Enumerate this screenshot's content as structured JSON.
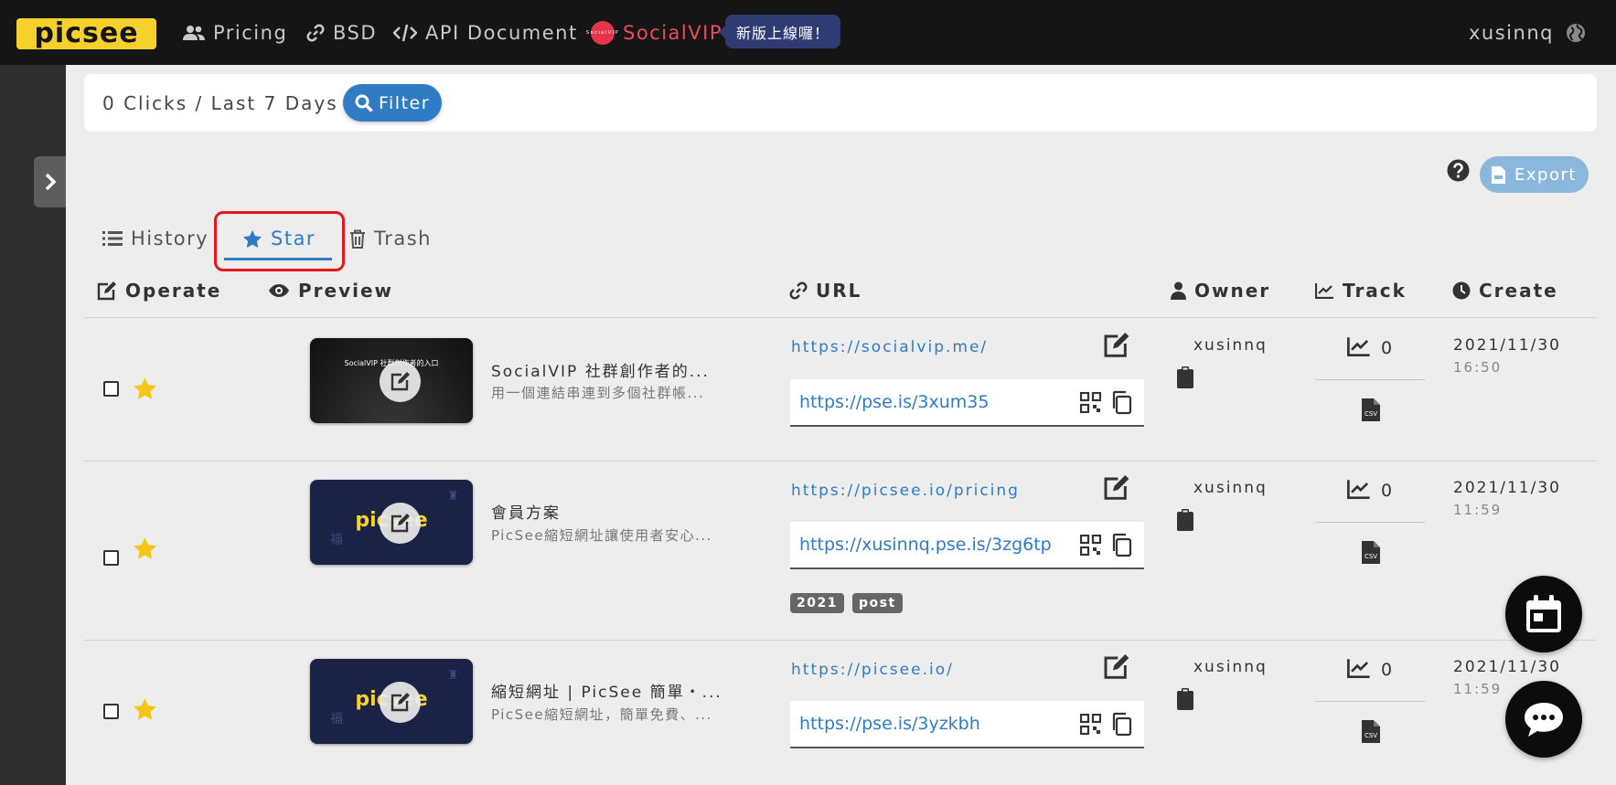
{
  "nav": {
    "logo": "picsee",
    "items": [
      {
        "label": "Pricing",
        "icon": "users-icon"
      },
      {
        "label": "BSD",
        "icon": "link-icon"
      },
      {
        "label": "API Document",
        "icon": "code-icon"
      },
      {
        "label": "SocialVIP",
        "icon": "socialvip-icon",
        "color": "#ef4a5c"
      }
    ],
    "socialvip_logo_text": "SocialVIP",
    "new_badge": "新版上線囉！",
    "user": "xusinnq"
  },
  "summary": {
    "text": "0 Clicks / Last 7 Days",
    "filter_label": "Filter"
  },
  "toolbar": {
    "export_label": "Export"
  },
  "tabs": [
    {
      "label": "History",
      "icon": "list-icon"
    },
    {
      "label": "Star",
      "icon": "star-icon",
      "active": true
    },
    {
      "label": "Trash",
      "icon": "trash-icon"
    }
  ],
  "columns": [
    "Operate",
    "Preview",
    "URL",
    "Owner",
    "Track",
    "Create"
  ],
  "rows": [
    {
      "starred": true,
      "thumb_type": "socialvip",
      "thumb_title": "SocialVIP 社群創作者的入口",
      "title": "SocialVIP 社群創作者的...",
      "description": "用一個連結串連到多個社群帳...",
      "original_url": "https://socialvip.me/",
      "short_url": "https://pse.is/3xum35",
      "tags": [],
      "owner": "xusinnq",
      "clicks": "0",
      "date": "2021/11/30",
      "time": "16:50"
    },
    {
      "starred": true,
      "thumb_type": "picsee",
      "thumb_logo": "picsee",
      "title": "會員方案",
      "description": "PicSee縮短網址讓使用者安心...",
      "original_url": "https://picsee.io/pricing",
      "short_url": "https://xusinnq.pse.is/3zg6tp",
      "tags": [
        "2021",
        "post"
      ],
      "owner": "xusinnq",
      "clicks": "0",
      "date": "2021/11/30",
      "time": "11:59"
    },
    {
      "starred": true,
      "thumb_type": "picsee",
      "thumb_logo": "picsee",
      "title": "縮短網址 | PicSee 簡單・...",
      "description": "PicSee縮短網址，簡單免費、...",
      "original_url": "https://picsee.io/",
      "short_url": "https://pse.is/3yzkbh",
      "tags": [],
      "owner": "xusinnq",
      "clicks": "0",
      "date": "2021/11/30",
      "time": "11:59"
    }
  ],
  "colors": {
    "accent": "#2f7bc4",
    "logo_yellow": "#f6d02b",
    "star_yellow": "#f5c518",
    "highlight_red": "#e01818"
  }
}
